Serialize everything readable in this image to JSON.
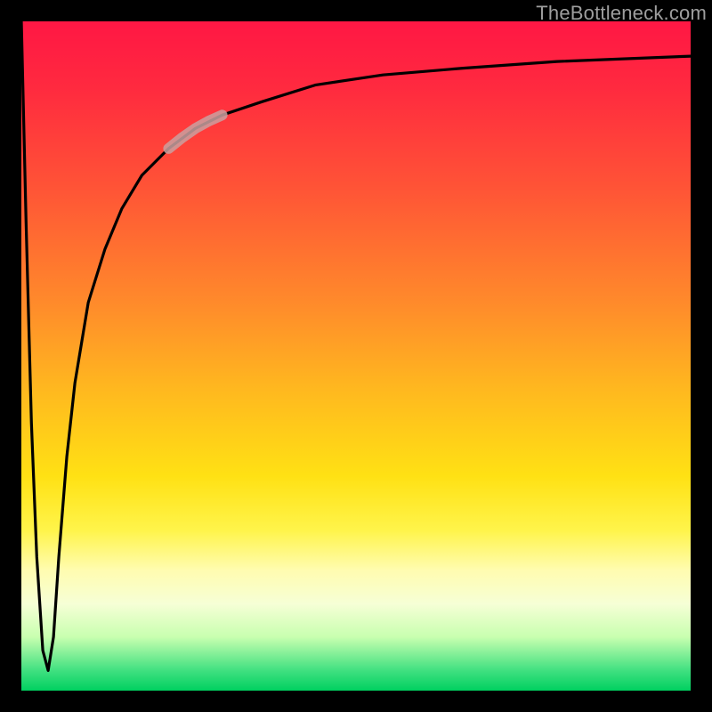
{
  "attribution": "TheBottleneck.com",
  "chart_data": {
    "type": "line",
    "title": "",
    "xlabel": "",
    "ylabel": "",
    "xlim": [
      0,
      100
    ],
    "ylim": [
      0,
      100
    ],
    "curve": {
      "x": [
        0.0,
        0.7,
        1.5,
        2.3,
        3.2,
        4.0,
        4.8,
        5.6,
        6.8,
        8.0,
        10.0,
        12.5,
        15.0,
        18.0,
        22.0,
        26.0,
        30.0,
        36.0,
        44.0,
        54.0,
        66.0,
        80.0,
        100.0
      ],
      "y": [
        100,
        70,
        40,
        20,
        6,
        3,
        8,
        20,
        35,
        46,
        58,
        66,
        72,
        77,
        81,
        84,
        86,
        88,
        90.5,
        92,
        93,
        94,
        94.8
      ]
    },
    "highlight_segment": {
      "x": [
        22.0,
        24.0,
        26.0,
        28.0,
        30.0
      ],
      "y": [
        81.0,
        82.6,
        84.0,
        85.1,
        86.0
      ]
    },
    "gradient_stops": [
      {
        "pos": 0.0,
        "color": "#ff1744"
      },
      {
        "pos": 0.42,
        "color": "#ff8a2b"
      },
      {
        "pos": 0.68,
        "color": "#ffe114"
      },
      {
        "pos": 0.87,
        "color": "#f6ffd6"
      },
      {
        "pos": 1.0,
        "color": "#00d060"
      }
    ]
  }
}
